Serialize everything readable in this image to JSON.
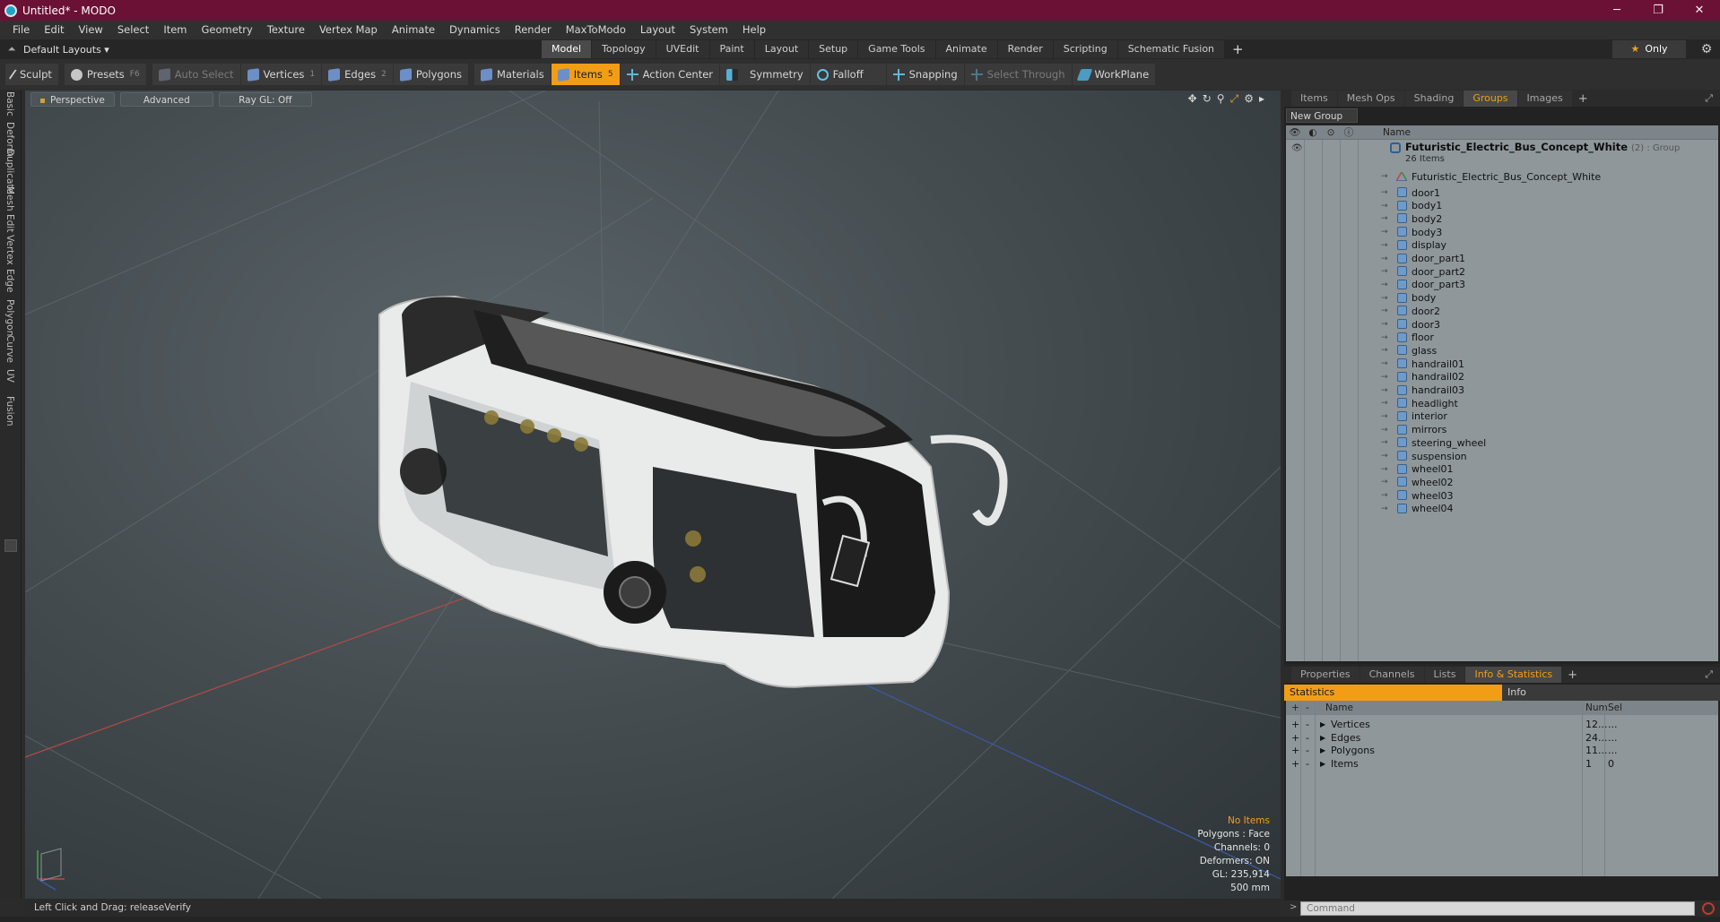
{
  "window": {
    "title": "Untitled* - MODO",
    "controls": [
      "─",
      "❐",
      "✕"
    ]
  },
  "menubar": [
    "File",
    "Edit",
    "View",
    "Select",
    "Item",
    "Geometry",
    "Texture",
    "Vertex Map",
    "Animate",
    "Dynamics",
    "Render",
    "MaxToModo",
    "Layout",
    "System",
    "Help"
  ],
  "layoutbar": {
    "layout_name": "Default Layouts ▾",
    "tabs": [
      "Model",
      "Topology",
      "UVEdit",
      "Paint",
      "Layout",
      "Setup",
      "Game Tools",
      "Animate",
      "Render",
      "Scripting",
      "Schematic Fusion"
    ],
    "active_tab": "Model",
    "only_label": "Only"
  },
  "toolbar": {
    "sculpt": "Sculpt",
    "presets": "Presets",
    "presets_key": "F6",
    "auto_select": "Auto Select",
    "vertices": "Vertices",
    "vertices_key": "1",
    "edges": "Edges",
    "edges_key": "2",
    "polygons": "Polygons",
    "materials": "Materials",
    "items": "Items",
    "items_key": "5",
    "action_center": "Action Center",
    "symmetry": "Symmetry",
    "falloff": "Falloff",
    "snapping": "Snapping",
    "select_through": "Select Through",
    "workplane": "WorkPlane"
  },
  "left_tabs": [
    "Basic",
    "Deform",
    "Duplicate",
    "Mesh Edit",
    "Vertex",
    "Edge",
    "Polygon",
    "Curve",
    "UV",
    "Fusion"
  ],
  "viewport": {
    "view_mode": "Perspective",
    "shading": "Advanced",
    "raygl": "Ray GL: Off",
    "info": {
      "selection": "No Items",
      "polygons": "Polygons : Face",
      "channels": "Channels: 0",
      "deformers": "Deformers: ON",
      "gl": "GL: 235,914",
      "scale": "500 mm"
    }
  },
  "statusbar": {
    "text": "Left Click and Drag:  releaseVerify"
  },
  "groups_panel": {
    "tabs": [
      "Items",
      "Mesh Ops",
      "Shading",
      "Groups",
      "Images"
    ],
    "active_tab": "Groups",
    "new_group": "New Group",
    "column_name": "Name",
    "group": {
      "name": "Futuristic_Electric_Bus_Concept_White",
      "suffix": "(2) : Group",
      "count": "26 Items",
      "locator": "Futuristic_Electric_Bus_Concept_White"
    },
    "items": [
      "door1",
      "body1",
      "body2",
      "body3",
      "display",
      "door_part1",
      "door_part2",
      "door_part3",
      "body",
      "door2",
      "door3",
      "floor",
      "glass",
      "handrail01",
      "handrail02",
      "handrail03",
      "headlight",
      "interior",
      "mirrors",
      "steering_wheel",
      "suspension",
      "wheel01",
      "wheel02",
      "wheel03",
      "wheel04"
    ]
  },
  "stats_panel": {
    "tabs": [
      "Properties",
      "Channels",
      "Lists",
      "Info & Statistics"
    ],
    "active_tab": "Info & Statistics",
    "sub_tabs": [
      "Statistics",
      "Info"
    ],
    "columns": [
      "Name",
      "Num",
      "Sel"
    ],
    "rows": [
      {
        "name": "Vertices",
        "num": "12...",
        "sel": "..."
      },
      {
        "name": "Edges",
        "num": "24...",
        "sel": "..."
      },
      {
        "name": "Polygons",
        "num": "11...",
        "sel": "..."
      },
      {
        "name": "Items",
        "num": "1",
        "sel": "0"
      }
    ]
  },
  "command": {
    "placeholder": "Command"
  },
  "colors": {
    "accent": "#f29d16",
    "titlebar": "#6b1136"
  }
}
